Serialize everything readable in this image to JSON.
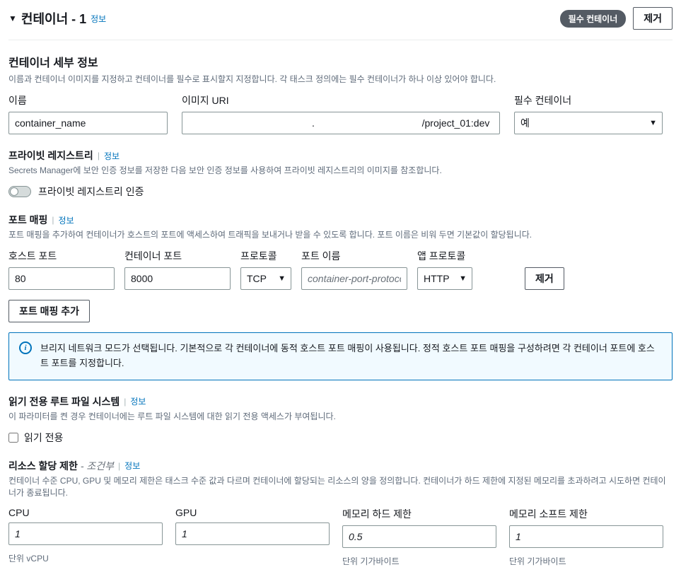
{
  "header": {
    "title": "컨테이너 - 1",
    "info_link": "정보",
    "badge": "필수 컨테이너",
    "remove_btn": "제거"
  },
  "details": {
    "title": "컨테이너 세부 정보",
    "desc": "이름과 컨테이너 이미지를 지정하고 컨테이너를 필수로 표시할지 지정합니다. 각 태스크 정의에는 필수 컨테이너가 하나 이상 있어야 합니다.",
    "name_label": "이름",
    "name_value": "container_name",
    "image_label": "이미지 URI",
    "image_value": "                                             .                                       /project_01:dev",
    "essential_label": "필수 컨테이너",
    "essential_value": "예"
  },
  "registry": {
    "title": "프라이빗 레지스트리",
    "info_link": "정보",
    "desc": "Secrets Manager에 보안 인증 정보를 저장한 다음 보안 인증 정보를 사용하여 프라이빗 레지스트리의 이미지를 참조합니다.",
    "toggle_label": "프라이빗 레지스트리 인증"
  },
  "port": {
    "title": "포트 매핑",
    "info_link": "정보",
    "desc": "포트 매핑을 추가하여 컨테이너가 호스트의 포트에 액세스하여 트래픽을 보내거나 받을 수 있도록 합니다. 포트 이름은 비워 두면 기본값이 할당됩니다.",
    "host_label": "호스트 포트",
    "host_value": "80",
    "container_label": "컨테이너 포트",
    "container_value": "8000",
    "protocol_label": "프로토콜",
    "protocol_value": "TCP",
    "portname_label": "포트 이름",
    "portname_placeholder": "container-port-protoco",
    "appproto_label": "앱 프로토콜",
    "appproto_value": "HTTP",
    "remove_btn": "제거",
    "add_btn": "포트 매핑 추가",
    "info_text": "브리지 네트워크 모드가 선택됩니다. 기본적으로 각 컨테이너에 동적 호스트 포트 매핑이 사용됩니다. 정적 호스트 포트 매핑을 구성하려면 각 컨테이너 포트에 호스트 포트를 지정합니다."
  },
  "readonly": {
    "title": "읽기 전용 루트 파일 시스템",
    "info_link": "정보",
    "desc": "이 파라미터를 켠 경우 컨테이너에는 루트 파일 시스템에 대한 읽기 전용 액세스가 부여됩니다.",
    "checkbox_label": "읽기 전용"
  },
  "resource": {
    "title": "리소스 할당 제한",
    "conditional": " - 조건부",
    "info_link": "정보",
    "desc": "컨테이너 수준 CPU, GPU 및 메모리 제한은 태스크 수준 값과 다르며 컨테이너에 할당되는 리소스의 양을 정의합니다. 컨테이너가 하드 제한에 지정된 메모리를 초과하려고 시도하면 컨테이너가 종료됩니다.",
    "cpu_label": "CPU",
    "cpu_value": "1",
    "cpu_hint": "단위 vCPU",
    "gpu_label": "GPU",
    "gpu_value": "1",
    "mem_hard_label": "메모리 하드 제한",
    "mem_hard_value": "0.5",
    "mem_hard_hint": "단위 기가바이트",
    "mem_soft_label": "메모리 소프트 제한",
    "mem_soft_value": "1",
    "mem_soft_hint": "단위 기가바이트"
  }
}
